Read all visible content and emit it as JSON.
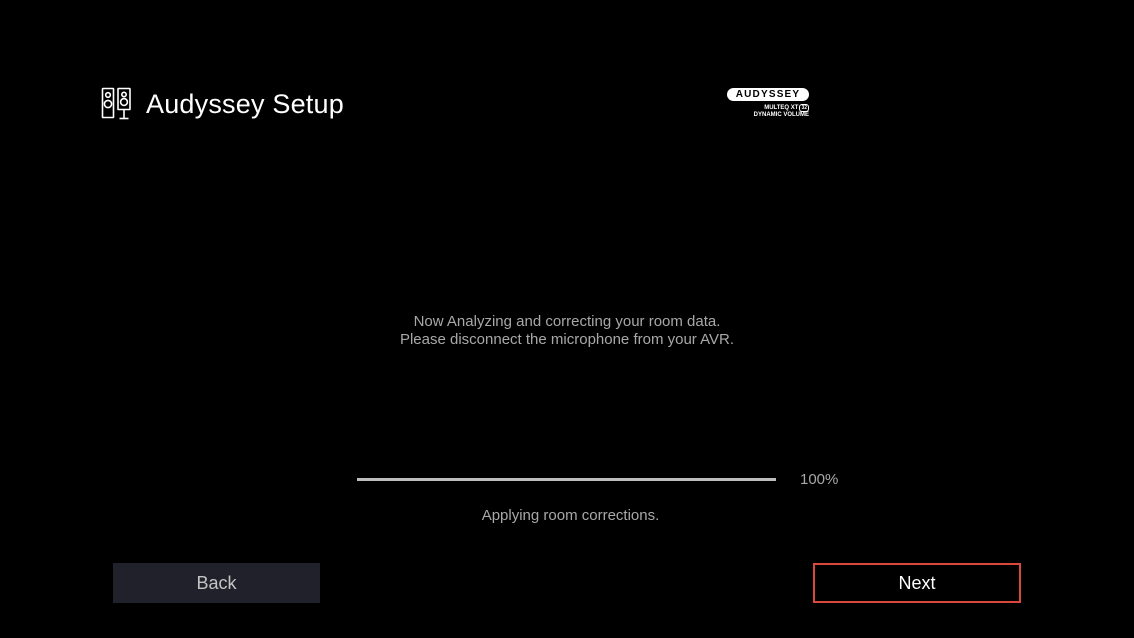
{
  "header": {
    "title": "Audyssey Setup",
    "icon": "speakers-icon"
  },
  "brand": {
    "name": "AUDYSSEY",
    "line1": "MULTEQ XT",
    "line1_badge": "32",
    "line2": "DYNAMIC VOLUME"
  },
  "message": {
    "line1": "Now Analyzing and correcting your room data.",
    "line2": "Please disconnect the microphone from your AVR."
  },
  "progress": {
    "value": 1.0,
    "label": "100%",
    "status": "Applying room corrections."
  },
  "buttons": {
    "back": "Back",
    "next": "Next"
  },
  "colors": {
    "background": "#000000",
    "focus_border": "#d9483b",
    "progress_fill": "#bdbdbd",
    "secondary_text": "#a8a8a8",
    "back_button_bg": "#21212b"
  }
}
